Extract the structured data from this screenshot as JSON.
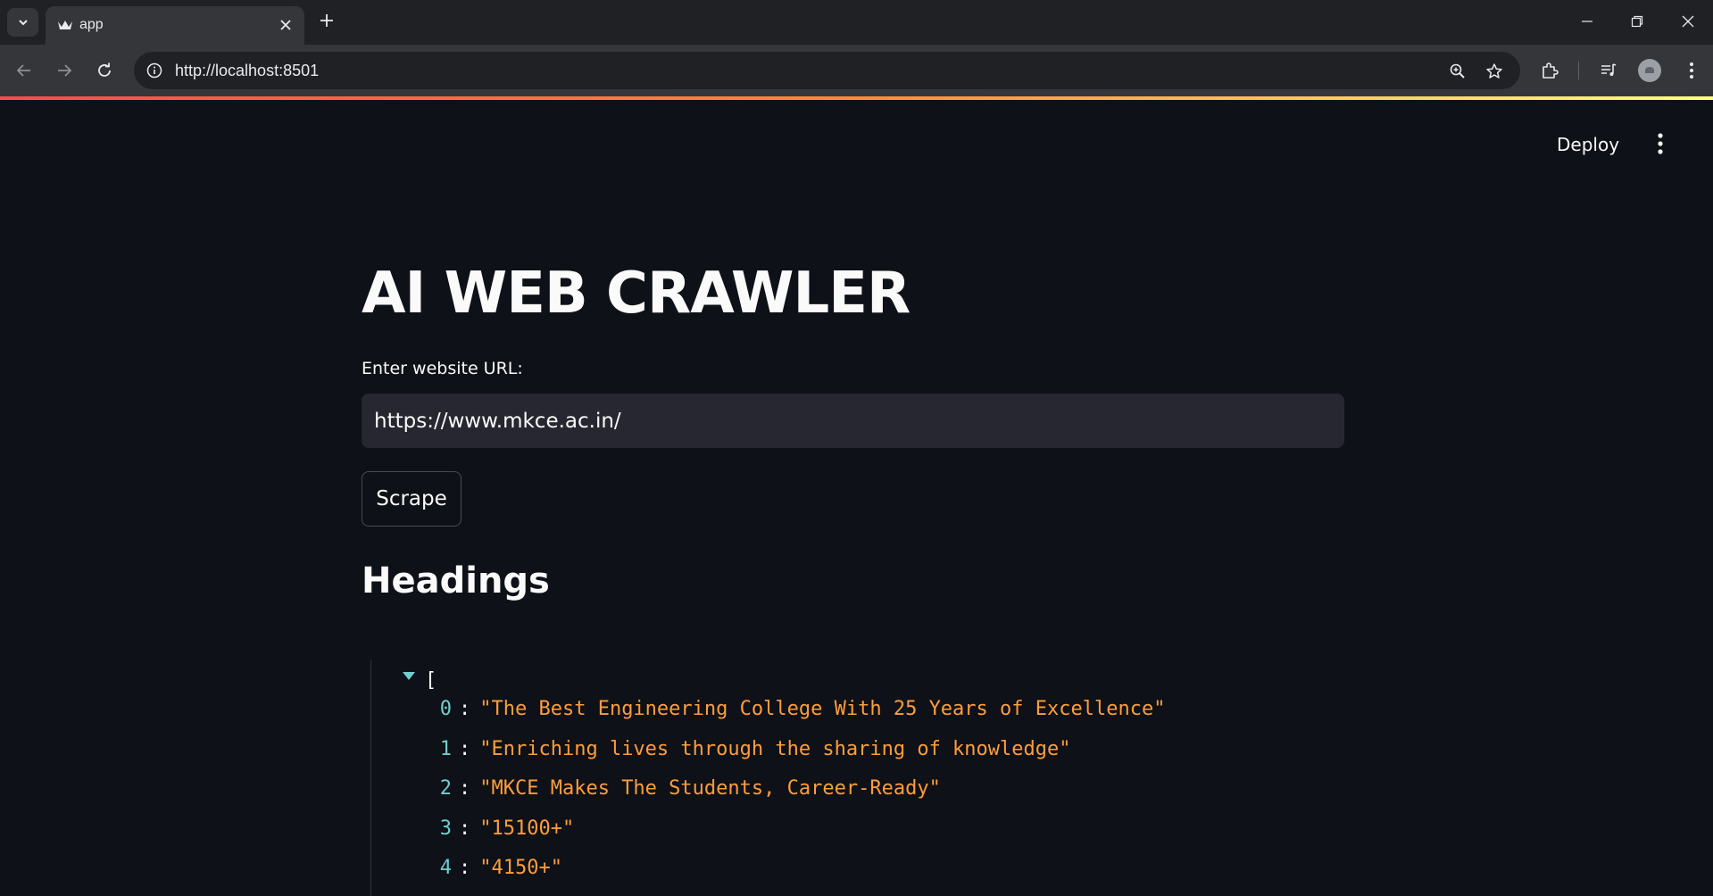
{
  "browser": {
    "tab_title": "app",
    "url": "http://localhost:8501"
  },
  "app": {
    "deploy_label": "Deploy",
    "title": "AI WEB CRAWLER",
    "input_label": "Enter website URL:",
    "input_value": "https://www.mkce.ac.in/",
    "button_label": "Scrape",
    "section_heading": "Headings",
    "json_open_bracket": "[",
    "json_items": [
      {
        "key": "0",
        "value": "\"The Best Engineering College With 25 Years of Excellence\""
      },
      {
        "key": "1",
        "value": "\"Enriching lives through the sharing of knowledge\""
      },
      {
        "key": "2",
        "value": "\"MKCE Makes The Students, Career-Ready\""
      },
      {
        "key": "3",
        "value": "\"15100+\""
      },
      {
        "key": "4",
        "value": "\"4150+\""
      }
    ]
  },
  "colors": {
    "background": "#0e1117",
    "input_bg": "#262730",
    "json_key": "#6fcfcf",
    "json_string": "#ff9d3b",
    "accent_gradient_start": "#ff4b4b",
    "accent_gradient_end": "#fffd80"
  }
}
